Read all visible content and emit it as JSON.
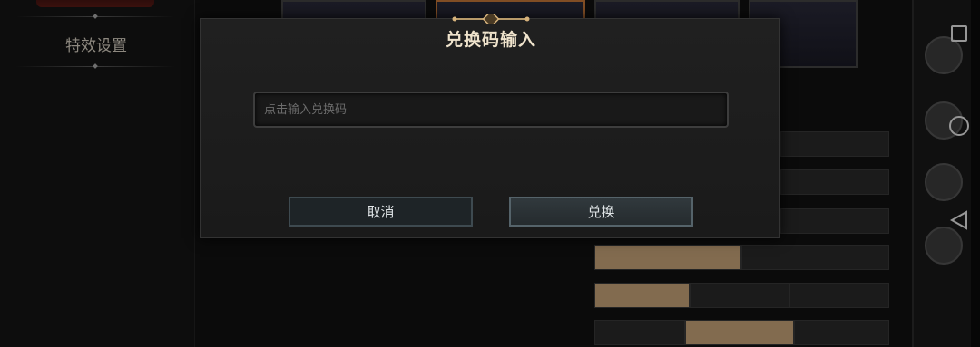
{
  "sidebar": {
    "items": [
      {
        "label": "特效设置"
      }
    ]
  },
  "modal": {
    "title": "兑换码输入",
    "input": {
      "placeholder": "点击输入兑换码",
      "value": ""
    },
    "cancel_label": "取消",
    "confirm_label": "兑换"
  },
  "colors": {
    "accent_gold": "#c8a57a",
    "modal_bg": "#1c1c1c",
    "title_text": "#efe3cc"
  },
  "icons": [
    "ornament-icon",
    "home-square-icon",
    "home-circle-icon",
    "back-triangle-icon"
  ]
}
